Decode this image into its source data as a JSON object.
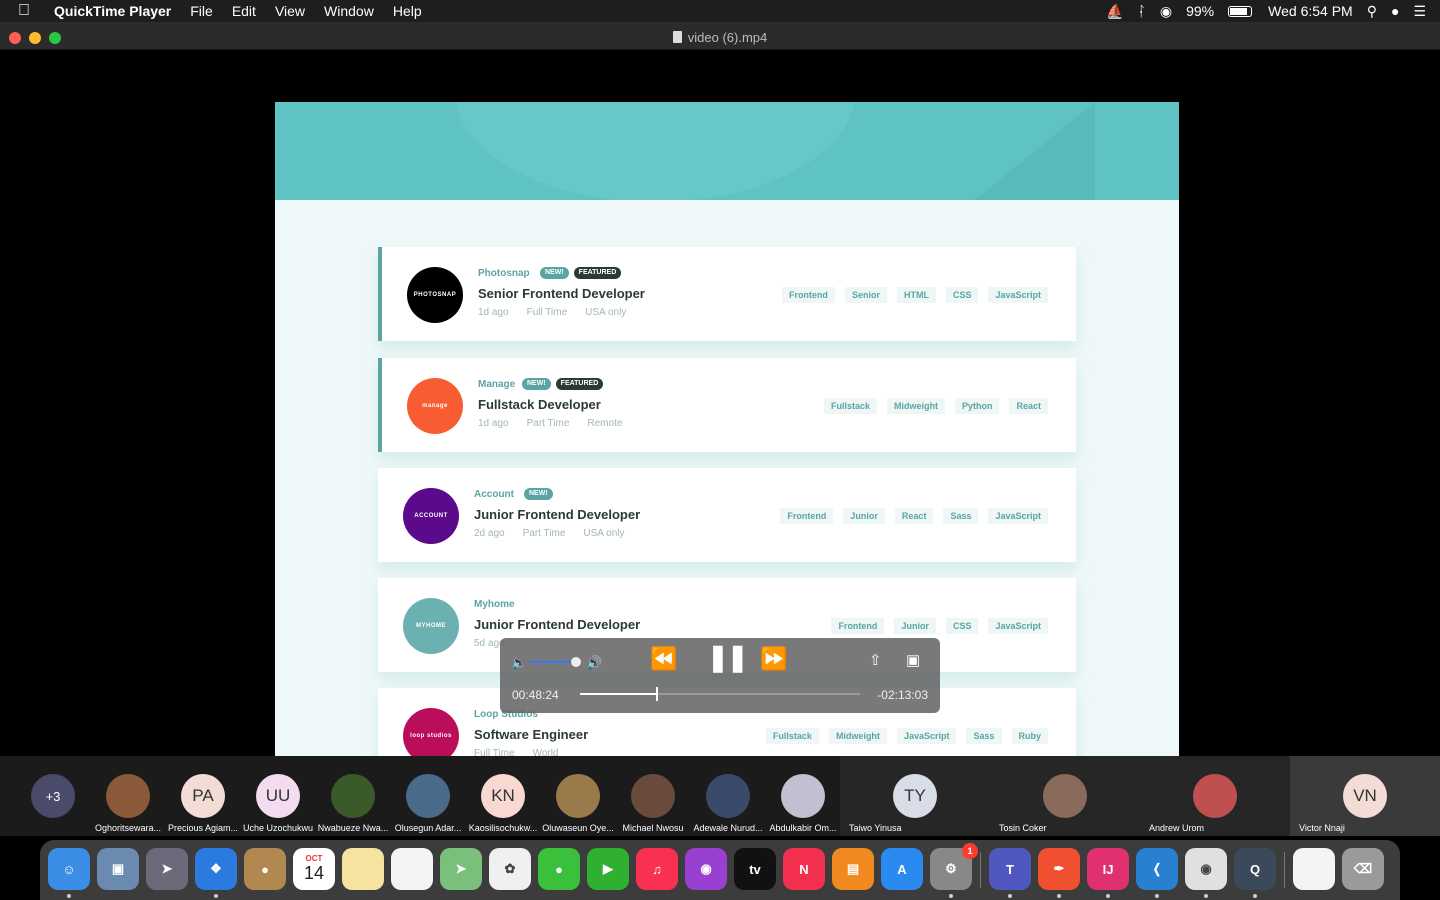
{
  "menubar": {
    "app_name": "QuickTime Player",
    "menus": [
      "File",
      "Edit",
      "View",
      "Window",
      "Help"
    ],
    "battery": "99%",
    "clock": "Wed 6:54 PM"
  },
  "window": {
    "title": "video (6).mp4"
  },
  "jobs": [
    {
      "company": "Photosnap",
      "logo_text": "PHOTOSNAP",
      "logo_color": "#000000",
      "new": "NEW!",
      "featured": "FEATURED",
      "position": "Senior Frontend Developer",
      "posted": "1d ago",
      "contract": "Full Time",
      "location": "USA only",
      "tags": [
        "Frontend",
        "Senior",
        "HTML",
        "CSS",
        "JavaScript"
      ]
    },
    {
      "company": "Manage",
      "logo_text": "manage",
      "logo_color": "#f85c32",
      "new": "NEW!",
      "featured": "FEATURED",
      "position": "Fullstack Developer",
      "posted": "1d ago",
      "contract": "Part Time",
      "location": "Remote",
      "tags": [
        "Fullstack",
        "Midweight",
        "Python",
        "React"
      ]
    },
    {
      "company": "Account",
      "logo_text": "ACCOUNT",
      "logo_color": "#5c0a8c",
      "new": "NEW!",
      "featured": "",
      "position": "Junior Frontend Developer",
      "posted": "2d ago",
      "contract": "Part Time",
      "location": "USA only",
      "tags": [
        "Frontend",
        "Junior",
        "React",
        "Sass",
        "JavaScript"
      ]
    },
    {
      "company": "Myhome",
      "logo_text": "MYHOME",
      "logo_color": "#6bb1b1",
      "new": "",
      "featured": "",
      "position": "Junior Frontend Developer",
      "posted": "5d ago",
      "contract": "",
      "location": "",
      "tags": [
        "Frontend",
        "Junior",
        "CSS",
        "JavaScript"
      ]
    },
    {
      "company": "Loop Studios",
      "logo_text": "loop studios",
      "logo_color": "#bb0e5a",
      "new": "",
      "featured": "",
      "position": "Software Engineer",
      "posted": "",
      "contract": "Full Time",
      "location": "World",
      "tags": [
        "Fullstack",
        "Midweight",
        "JavaScript",
        "Sass",
        "Ruby"
      ]
    }
  ],
  "player": {
    "elapsed": "00:48:24",
    "remaining": "-02:13:03",
    "progress": 0.27,
    "volume": 0.9,
    "icons": {
      "volume_low": "speaker-low-icon",
      "volume_high": "speaker-high-icon",
      "rewind": "rewind-icon",
      "pause": "pause-icon",
      "fast_forward": "fast-forward-icon",
      "share": "share-icon",
      "pip": "picture-in-picture-icon"
    }
  },
  "participants": {
    "overflow": "+3",
    "people": [
      {
        "initials": "",
        "name": "Oghoritsewara...",
        "color": "#8a5a3a"
      },
      {
        "initials": "PA",
        "name": "Precious Agiam...",
        "color": "#f4dcd6"
      },
      {
        "initials": "UU",
        "name": "Uche Uzochukwu",
        "color": "#f4dcf0"
      },
      {
        "initials": "",
        "name": "Nwabueze Nwa...",
        "color": "#3a5a2a"
      },
      {
        "initials": "",
        "name": "Olusegun Adar...",
        "color": "#4a6a8a"
      },
      {
        "initials": "KN",
        "name": "Kaosilisochukw...",
        "color": "#f8d8d0"
      },
      {
        "initials": "",
        "name": "Oluwaseun Oye...",
        "color": "#9a7a4a"
      },
      {
        "initials": "",
        "name": "Michael Nwosu",
        "color": "#6a4a3a"
      },
      {
        "initials": "",
        "name": "Adewale Nurud...",
        "color": "#3a4a6a"
      },
      {
        "initials": "",
        "name": "Abdulkabir Om...",
        "color": "#c0c0d0"
      }
    ],
    "tiles": [
      {
        "initials": "TY",
        "name": "Taiwo Yinusa",
        "color": "#d8dde8"
      },
      {
        "initials": "",
        "name": "Tosin Coker",
        "color": "#8a6a5a"
      },
      {
        "initials": "",
        "name": "Andrew Urom",
        "color": "#c05050"
      },
      {
        "initials": "VN",
        "name": "Victor Nnaji",
        "color": "#f4dcd6"
      }
    ]
  },
  "dock": {
    "calendar_month": "OCT",
    "calendar_day": "14",
    "appletv": "tv",
    "settings_badge": "1",
    "apps": [
      "finder-icon",
      "preview-icon",
      "launchpad-icon",
      "safari-icon",
      "contacts-icon",
      "calendar-icon",
      "notes-icon",
      "reminders-icon",
      "maps-icon",
      "photos-icon",
      "messages-icon",
      "facetime-icon",
      "music-icon",
      "podcasts-icon",
      "appletv-icon",
      "news-icon",
      "books-icon",
      "appstore-icon",
      "system-preferences-icon",
      "teams-icon",
      "swift-playgrounds-icon",
      "intellij-icon",
      "vscode-icon",
      "chrome-icon",
      "quicktime-icon",
      "document-icon",
      "trash-icon"
    ]
  }
}
